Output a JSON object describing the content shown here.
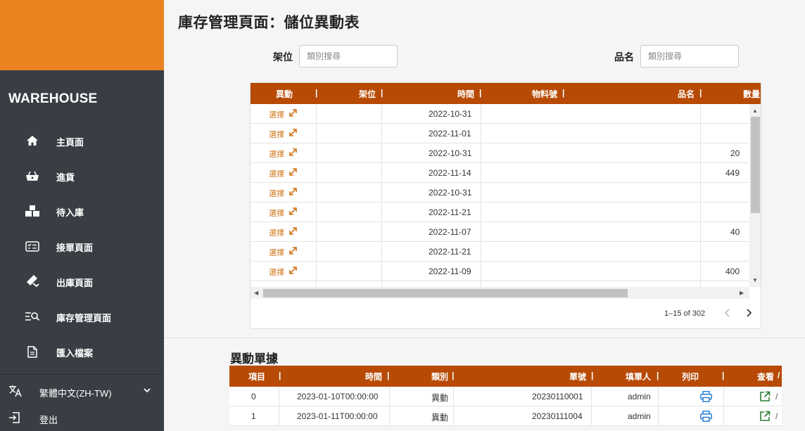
{
  "app": {
    "brand": "WAREHOUSE"
  },
  "sidebar": {
    "items": [
      {
        "label": "主頁面",
        "icon": "home-icon"
      },
      {
        "label": "進貨",
        "icon": "basket-icon"
      },
      {
        "label": "待入庫",
        "icon": "boxes-icon"
      },
      {
        "label": "接單頁面",
        "icon": "list-card-icon"
      },
      {
        "label": "出庫頁面",
        "icon": "hand-box-icon"
      },
      {
        "label": "庫存管理頁面",
        "icon": "list-search-icon"
      },
      {
        "label": "匯入檔案",
        "icon": "file-icon"
      }
    ],
    "language": "繁體中文(ZH-TW)",
    "logout": "登出"
  },
  "header": {
    "title": "庫存管理頁面：儲位異動表"
  },
  "filters": {
    "shelf_label": "架位",
    "shelf_placeholder": "類別搜尋",
    "name_label": "品名",
    "name_placeholder": "類別搜尋"
  },
  "stock_table": {
    "headers": [
      "異動",
      "架位",
      "時間",
      "物料號",
      "品名",
      "數量"
    ],
    "action_label": "選擇",
    "rows": [
      {
        "time": "2022-10-31",
        "qty": ""
      },
      {
        "time": "2022-11-01",
        "qty": ""
      },
      {
        "time": "2022-10-31",
        "qty": "20"
      },
      {
        "time": "2022-11-14",
        "qty": "449"
      },
      {
        "time": "2022-10-31",
        "qty": ""
      },
      {
        "time": "2022-11-21",
        "qty": ""
      },
      {
        "time": "2022-11-07",
        "qty": "40"
      },
      {
        "time": "2022-11-21",
        "qty": ""
      },
      {
        "time": "2022-11-09",
        "qty": "400"
      }
    ],
    "pagination": "1–15 of 302"
  },
  "movement": {
    "title": "異動單據",
    "headers": [
      "項目",
      "時間",
      "類別",
      "單號",
      "填單人",
      "列印",
      "查看"
    ],
    "rows": [
      {
        "item": "0",
        "time": "2023-01-10T00:00:00",
        "type": "異動",
        "number": "20230110001",
        "user": "admin"
      },
      {
        "item": "1",
        "time": "2023-01-11T00:00:00",
        "type": "異動",
        "number": "20230111004",
        "user": "admin"
      }
    ]
  },
  "colors": {
    "brand_orange": "#e88320",
    "header_rust": "#b74a05",
    "sidebar_dark": "#383e44",
    "action_orange": "#d0761a",
    "print_blue": "#1976d2",
    "view_green": "#2e7d32"
  }
}
